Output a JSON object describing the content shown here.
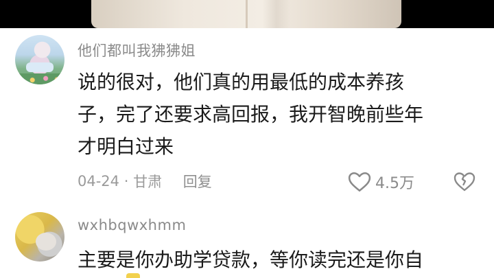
{
  "comments": [
    {
      "username": "他们都叫我狒狒姐",
      "content": "说的很对，他们真的用最低的成本养孩\n子，完了还要求高回报，我开智晚前些年\n才明白过来",
      "date": "04-24",
      "separator": "·",
      "location": "甘肃",
      "reply_label": "回复",
      "like_count": "4.5万"
    },
    {
      "username": "wxhbqwxhmm",
      "content": "主要是你办助学贷款，等你读完还是你自"
    }
  ],
  "icons": {
    "like": "heart-outline-icon",
    "dislike": "broken-heart-icon"
  },
  "colors": {
    "username": "#8a8a8a",
    "text": "#1a1a1a",
    "meta": "#9a9a9a"
  }
}
